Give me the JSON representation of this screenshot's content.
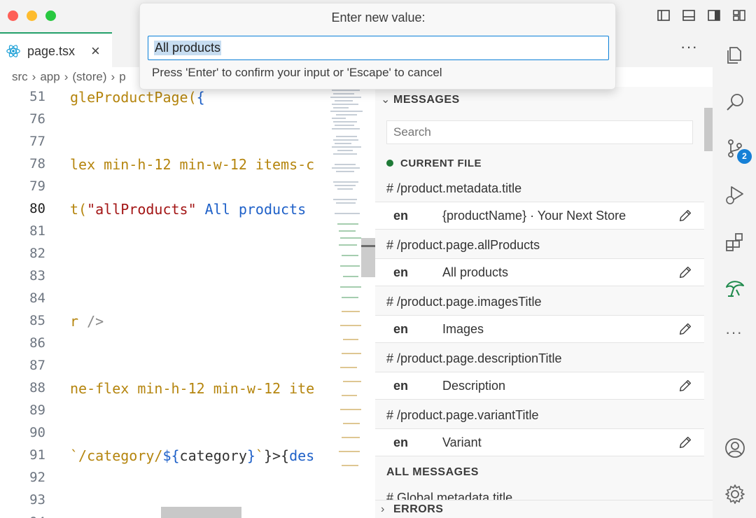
{
  "window": {
    "close_color": "#fe5f57",
    "minimize_color": "#febc2e",
    "maximize_color": "#28c840"
  },
  "layout_controls": [
    "toggle-primary-sidebar-icon",
    "toggle-panel-icon",
    "toggle-secondary-sidebar-icon",
    "customize-layout-icon"
  ],
  "tab": {
    "label": "page.tsx",
    "icon": "react-icon",
    "close": "×",
    "accent": "#23a06a"
  },
  "editor_actions": {
    "more": "···"
  },
  "breadcrumb": [
    "src",
    "app",
    "(store)",
    "p"
  ],
  "editor": {
    "active_line": "80",
    "lines": [
      {
        "n": "51"
      },
      {
        "n": "76"
      },
      {
        "n": "77"
      },
      {
        "n": "78"
      },
      {
        "n": "79"
      },
      {
        "n": "80"
      },
      {
        "n": "81"
      },
      {
        "n": "82"
      },
      {
        "n": "83"
      },
      {
        "n": "84"
      },
      {
        "n": "85"
      },
      {
        "n": "86"
      },
      {
        "n": "87"
      },
      {
        "n": "88"
      },
      {
        "n": "89"
      },
      {
        "n": "90"
      },
      {
        "n": "91"
      },
      {
        "n": "92"
      },
      {
        "n": "93"
      },
      {
        "n": "94"
      }
    ],
    "code": {
      "l51_a": "gleProductPage(",
      "l51_b": "{",
      "l78": "lex min-h-12 min-w-12 items-c",
      "l80_a": "t(",
      "l80_str": "\"allProducts\"",
      "l80_hint": " All products",
      "l85_a": "r ",
      "l85_b": "/>",
      "l88": "ne-flex min-h-12 min-w-12 ite",
      "l91_a": "`/category/",
      "l91_b": "${",
      "l91_c": "category",
      "l91_d": "}",
      "l91_e": "`",
      "l91_f": "}>{",
      "l91_g": "des"
    }
  },
  "quick_input": {
    "title": "Enter new value:",
    "value": "All products",
    "hint": "Press 'Enter' to confirm your input or 'Escape' to cancel"
  },
  "messages_panel": {
    "header": "MESSAGES",
    "search_placeholder": "Search",
    "current_file": "CURRENT FILE",
    "current_file_color": "#1f7a37",
    "entries": [
      {
        "key": "# /product.metadata.title",
        "lang": "en",
        "value": "{productName} · Your Next Store"
      },
      {
        "key": "# /product.page.allProducts",
        "lang": "en",
        "value": "All products"
      },
      {
        "key": "# /product.page.imagesTitle",
        "lang": "en",
        "value": "Images"
      },
      {
        "key": "# /product.page.descriptionTitle",
        "lang": "en",
        "value": "Description"
      },
      {
        "key": "# /product.page.variantTitle",
        "lang": "en",
        "value": "Variant"
      }
    ],
    "all_messages": "ALL MESSAGES",
    "partial_key": "# Global.metadata.title",
    "errors": "ERRORS"
  },
  "activity_bar": {
    "items": [
      "explorer-icon",
      "search-icon",
      "source-control-icon",
      "run-debug-icon",
      "extensions-icon",
      "i18n-extension-icon"
    ],
    "source_control_badge": "2",
    "badge_color": "#1680d6",
    "more": "···",
    "bottom": [
      "accounts-icon",
      "manage-gear-icon"
    ]
  }
}
